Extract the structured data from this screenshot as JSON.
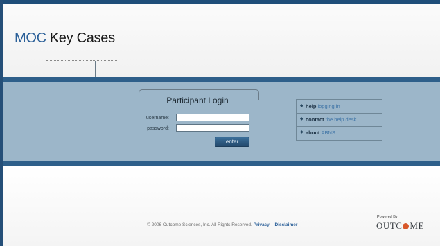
{
  "header": {
    "logo_moc": "MOC",
    "logo_title": "Key Cases"
  },
  "login": {
    "title": "Participant Login",
    "username_label": "username:",
    "password_label": "password:",
    "username_value": "",
    "password_value": "",
    "enter_label": "enter"
  },
  "links": {
    "items": [
      {
        "keyword": "help",
        "link": "logging in"
      },
      {
        "keyword": "contact",
        "link": "the help desk"
      },
      {
        "keyword": "about",
        "link": "ABNS"
      }
    ]
  },
  "footer": {
    "copyright": "© 2006 Outcome Sciences, Inc. All Rights Reserved.",
    "privacy": "Privacy",
    "separator": "|",
    "disclaimer": "Disclaimer"
  },
  "brand": {
    "powered_by": "Powered By",
    "name_left": "OUTC",
    "name_right": "ME"
  },
  "colors": {
    "band": "#9cb6c9",
    "band_edge": "#2e5f8a",
    "accent": "#2a5f98",
    "brand_dot": "#d8572a"
  }
}
